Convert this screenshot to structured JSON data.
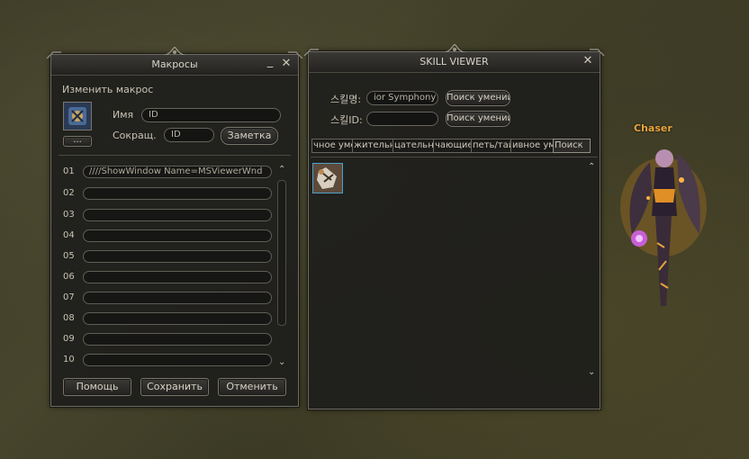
{
  "macro_window": {
    "title": "Макросы",
    "edit_label": "Изменить макрос",
    "icon_button_label": "...",
    "name_label": "Имя",
    "name_value": "ID",
    "short_label": "Сокращ.",
    "short_value": "ID",
    "note_button": "Заметка",
    "rows": [
      {
        "num": "01",
        "value": "////ShowWindow Name=MSViewerWnd"
      },
      {
        "num": "02",
        "value": ""
      },
      {
        "num": "03",
        "value": ""
      },
      {
        "num": "04",
        "value": ""
      },
      {
        "num": "05",
        "value": ""
      },
      {
        "num": "06",
        "value": ""
      },
      {
        "num": "07",
        "value": ""
      },
      {
        "num": "08",
        "value": ""
      },
      {
        "num": "09",
        "value": ""
      },
      {
        "num": "10",
        "value": ""
      }
    ],
    "help_button": "Помощь",
    "save_button": "Сохранить",
    "cancel_button": "Отменить"
  },
  "skill_viewer": {
    "title": "SKILL VIEWER",
    "skill_name_label": "스킬명:",
    "skill_name_value": "ior Symphony",
    "skill_search_button": "Поиск умений",
    "skill_id_label": "스킬ID:",
    "skill_id_value": "",
    "skill_id_search_button": "Поиск умений",
    "tabs": [
      {
        "label": "чное умение"
      },
      {
        "label": "жительные"
      },
      {
        "label": "цательные"
      },
      {
        "label": "чающие"
      },
      {
        "label": "петь/тайные"
      },
      {
        "label": "ивное умение"
      },
      {
        "label": "Поиск"
      }
    ]
  },
  "character": {
    "name": "Chaser"
  },
  "icons": {
    "close": "close-icon",
    "minimize": "minimize-icon",
    "skill": "skill-icon",
    "scroll_up": "chevron-up-icon",
    "scroll_down": "chevron-down-icon"
  }
}
